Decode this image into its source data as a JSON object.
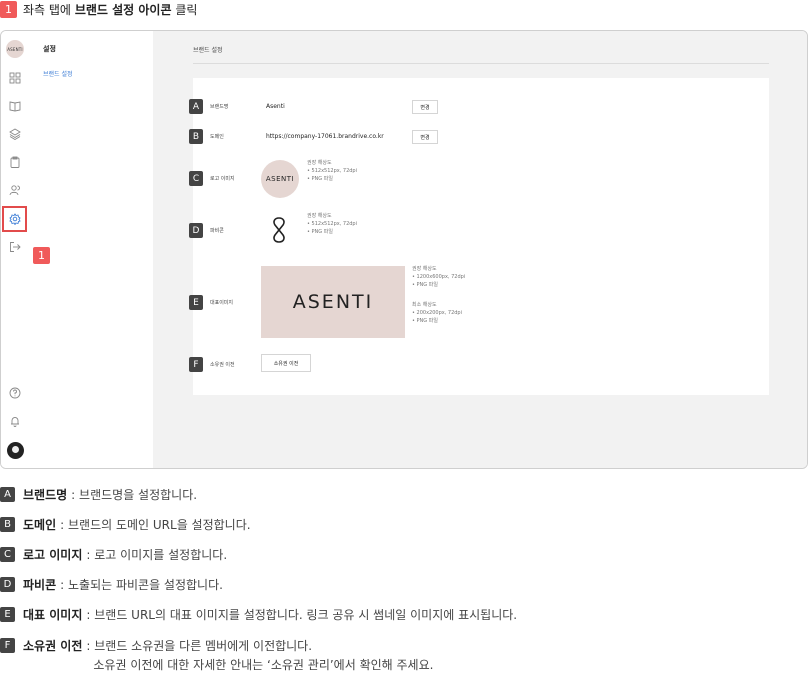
{
  "instruction": {
    "step": "1",
    "prefix": "좌측 탭에",
    "bold": "브랜드 설정 아이콘",
    "suffix": "클릭"
  },
  "rail": {
    "brand_avatar_text": "ASENTI",
    "icons": [
      "grid-icon",
      "book-icon",
      "layers-icon",
      "clipboard-icon",
      "users-icon",
      "settings-icon",
      "logout-icon",
      "help-icon",
      "bell-icon"
    ]
  },
  "submenu": {
    "title": "설정",
    "active_item": "브랜드 설정"
  },
  "main": {
    "page_title": "브랜드 설정",
    "rows": {
      "brand_name": {
        "badge": "A",
        "label": "브랜드명",
        "value": "Asenti",
        "button": "변경"
      },
      "domain": {
        "badge": "B",
        "label": "도메인",
        "value": "https://company-17061.brandrive.co.kr",
        "button": "변경"
      },
      "logo": {
        "badge": "C",
        "label": "로고 이미지",
        "image_text": "ASENTI",
        "hint_title": "권장 해상도",
        "hint_1": "• 512x512px, 72dpi",
        "hint_2": "• PNG 파일"
      },
      "favicon": {
        "badge": "D",
        "label": "파비콘",
        "hint_title": "권장 해상도",
        "hint_1": "• 512x512px, 72dpi",
        "hint_2": "• PNG 파일"
      },
      "rep_image": {
        "badge": "E",
        "label": "대표이미지",
        "image_text": "ASENTI",
        "hint_title": "권장 해상도",
        "hint_1": "• 1200x600px, 72dpi",
        "hint_2": "• PNG 파일",
        "hint_title_2": "최소 해상도",
        "hint_3": "• 200x200px, 72dpi",
        "hint_4": "• PNG 파일"
      },
      "ownership": {
        "badge": "F",
        "label": "소유권 이전",
        "button": "소유권 이전"
      }
    }
  },
  "callout_step": "1",
  "legend": [
    {
      "badge": "A",
      "name": "브랜드명",
      "desc": ": 브랜드명을 설정합니다."
    },
    {
      "badge": "B",
      "name": "도메인",
      "desc": ": 브랜드의 도메인 URL을 설정합니다."
    },
    {
      "badge": "C",
      "name": "로고 이미지",
      "desc": ": 로고 이미지를 설정합니다."
    },
    {
      "badge": "D",
      "name": "파비콘",
      "desc": ": 노출되는 파비콘을 설정합니다."
    },
    {
      "badge": "E",
      "name": "대표 이미지",
      "desc": ": 브랜드 URL의 대표 이미지를 설정합니다. 링크 공유 시 썸네일 이미지에 표시됩니다."
    },
    {
      "badge": "F",
      "name": "소유권 이전",
      "desc": ": 브랜드 소유권을 다른 멤버에게 이전합니다.",
      "desc2": "소유권 이전에 대한 자세한 안내는 ‘소유권 관리’에서 확인해 주세요."
    }
  ]
}
